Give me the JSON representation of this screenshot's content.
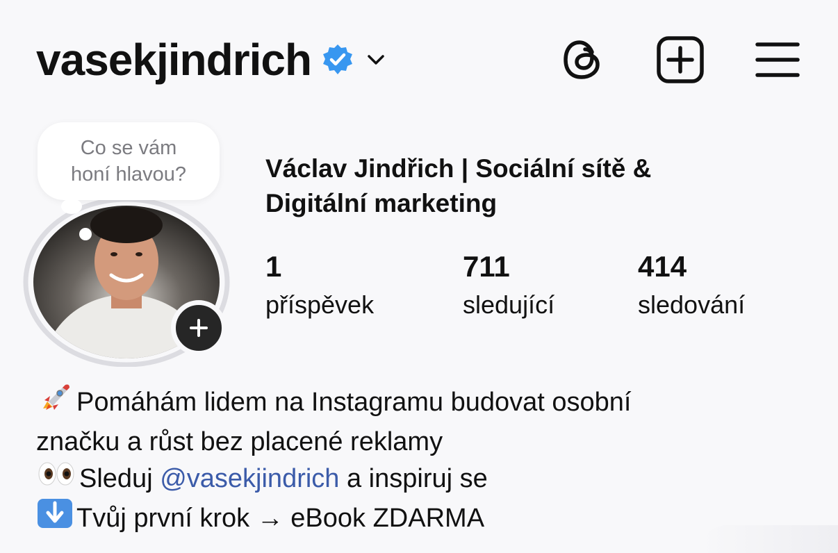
{
  "header": {
    "username": "vasekjindrich",
    "verified_icon": "verified-badge-icon",
    "dropdown_icon": "chevron-down-icon",
    "icons": [
      "threads-icon",
      "create-post-icon",
      "menu-icon"
    ]
  },
  "note": {
    "line1": "Co se vám",
    "line2": "honí hlavou?"
  },
  "profile": {
    "full_name_line1": "Václav Jindřich | Sociální sítě &",
    "full_name_line2": "Digitální marketing"
  },
  "stats": {
    "posts": {
      "value": "1",
      "label": "příspěvek"
    },
    "followers": {
      "value": "711",
      "label": "sledující"
    },
    "following": {
      "value": "414",
      "label": "sledování"
    }
  },
  "bio": {
    "line1": "Pomáhám lidem na Instagramu budovat osobní",
    "line2": "značku a růst bez placené reklamy",
    "line3_prefix": "Sleduj ",
    "line3_mention": "@vasekjindrich",
    "line3_suffix": " a inspiruj se",
    "line4": "Tvůj první krok → eBook ZDARMA"
  },
  "colors": {
    "background": "#f8f8fa",
    "verified_blue": "#3897f0",
    "mention_blue": "#3b5ba9",
    "text": "#111111",
    "note_text": "#7b7b80"
  }
}
